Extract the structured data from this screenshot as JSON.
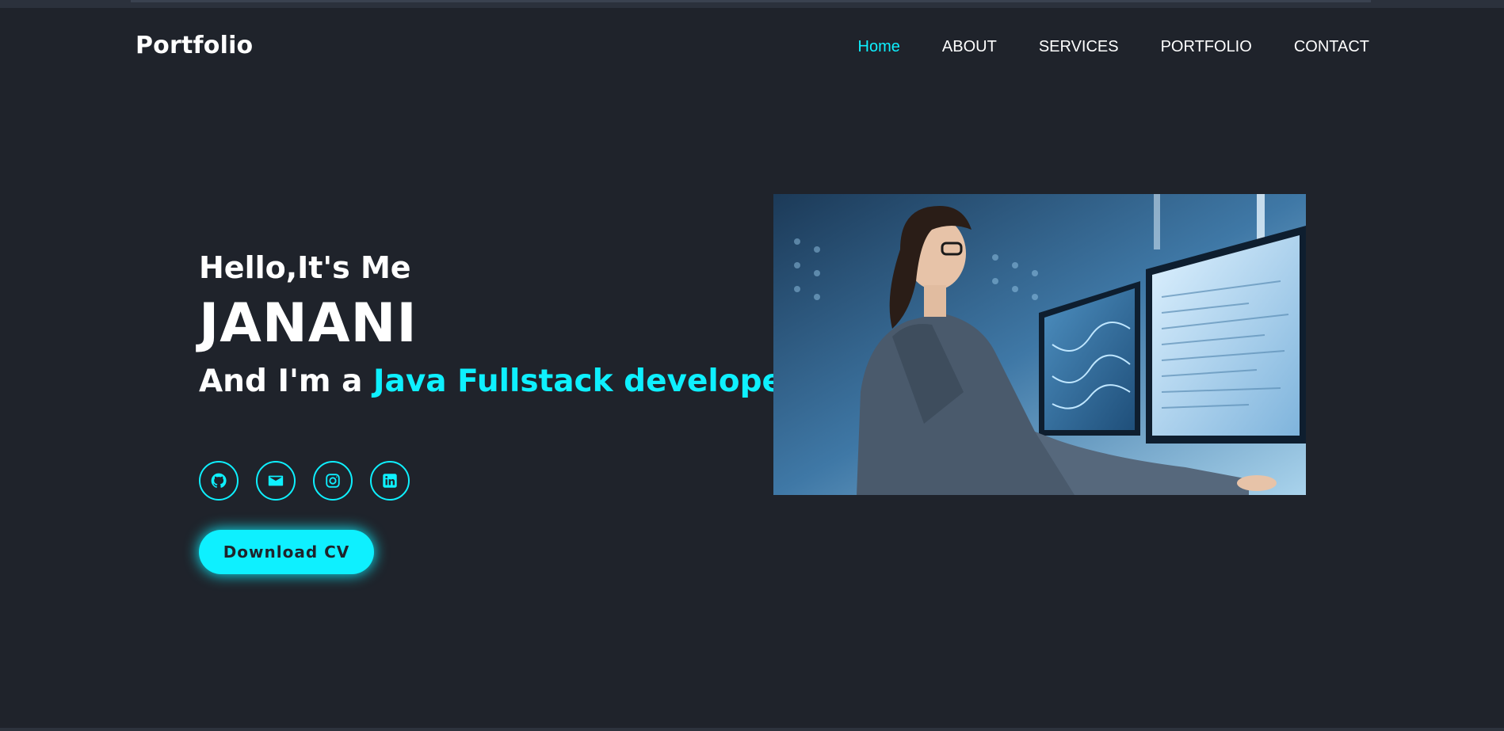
{
  "header": {
    "logo": "Portfolio",
    "nav": [
      {
        "label": "Home",
        "active": true
      },
      {
        "label": "ABOUT",
        "active": false
      },
      {
        "label": "SERVICES",
        "active": false
      },
      {
        "label": "PORTFOLIO",
        "active": false
      },
      {
        "label": "CONTACT",
        "active": false
      }
    ]
  },
  "hero": {
    "greeting": "Hello,It's Me",
    "name": "JANANI",
    "role_prefix": "And I'm a ",
    "role_highlight": "Java Fullstack developer",
    "cursor": "|",
    "socials": [
      {
        "icon": "github-icon"
      },
      {
        "icon": "mail-icon"
      },
      {
        "icon": "instagram-icon"
      },
      {
        "icon": "linkedin-icon"
      }
    ],
    "cta_label": "Download CV"
  },
  "colors": {
    "background": "#1f232b",
    "accent": "#0ef0ff",
    "text": "#ffffff"
  }
}
